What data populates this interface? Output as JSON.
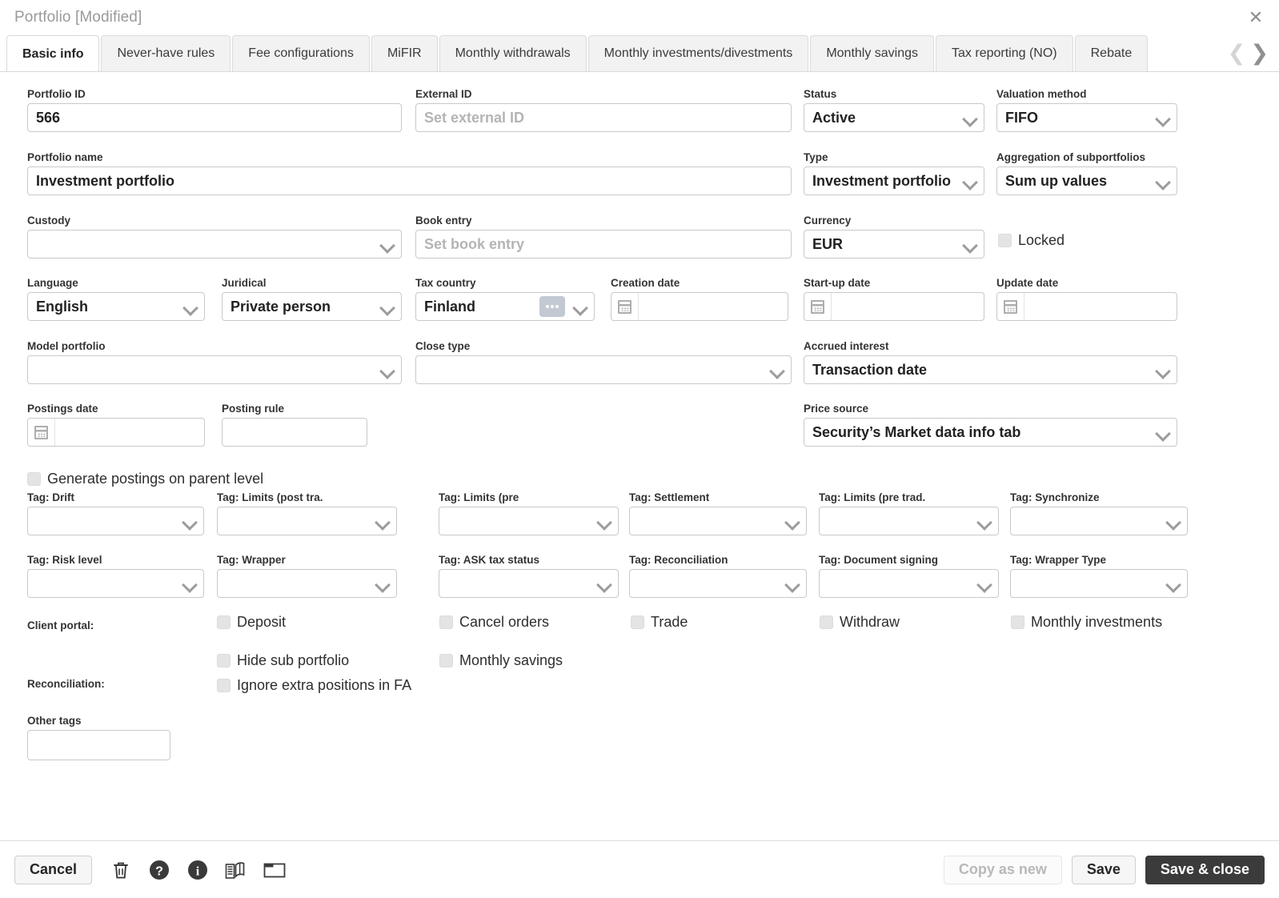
{
  "window": {
    "title": "Portfolio [Modified]",
    "close_icon": "close-icon"
  },
  "tabs": {
    "items": [
      {
        "label": "Basic info",
        "active": true
      },
      {
        "label": "Never-have rules",
        "active": false
      },
      {
        "label": "Fee configurations",
        "active": false
      },
      {
        "label": "MiFIR",
        "active": false
      },
      {
        "label": "Monthly withdrawals",
        "active": false
      },
      {
        "label": "Monthly investments/divestments",
        "active": false
      },
      {
        "label": "Monthly savings",
        "active": false
      },
      {
        "label": "Tax reporting (NO)",
        "active": false
      },
      {
        "label": "Rebate",
        "active": false
      }
    ],
    "prev_arrow": "❮",
    "next_arrow": "❯"
  },
  "form": {
    "portfolio_id": {
      "label": "Portfolio ID",
      "value": "566"
    },
    "external_id": {
      "label": "External ID",
      "value": "",
      "placeholder": "Set external ID"
    },
    "status": {
      "label": "Status",
      "value": "Active"
    },
    "valuation_method": {
      "label": "Valuation method",
      "value": "FIFO"
    },
    "portfolio_name": {
      "label": "Portfolio name",
      "value": "Investment portfolio"
    },
    "type": {
      "label": "Type",
      "value": "Investment portfolio"
    },
    "aggregation": {
      "label": "Aggregation of subportfolios",
      "value": "Sum up values"
    },
    "custody": {
      "label": "Custody",
      "value": ""
    },
    "book_entry": {
      "label": "Book entry",
      "value": "",
      "placeholder": "Set book entry"
    },
    "currency": {
      "label": "Currency",
      "value": "EUR"
    },
    "locked": {
      "label": "Locked",
      "checked": false
    },
    "language": {
      "label": "Language",
      "value": "English"
    },
    "juridical": {
      "label": "Juridical",
      "value": "Private person"
    },
    "tax_country": {
      "label": "Tax country",
      "value": "Finland"
    },
    "creation_date": {
      "label": "Creation date",
      "value": ""
    },
    "startup_date": {
      "label": "Start-up date",
      "value": ""
    },
    "update_date": {
      "label": "Update date",
      "value": ""
    },
    "model_portfolio": {
      "label": "Model portfolio",
      "value": ""
    },
    "close_type": {
      "label": "Close type",
      "value": ""
    },
    "accrued_interest": {
      "label": "Accrued interest",
      "value": "Transaction date"
    },
    "postings_date": {
      "label": "Postings date",
      "value": ""
    },
    "posting_rule": {
      "label": "Posting rule",
      "value": ""
    },
    "price_source": {
      "label": "Price source",
      "value": "Security’s Market data info tab"
    },
    "generate_postings": {
      "label": "Generate postings on parent level",
      "checked": false
    },
    "other_tags": {
      "label": "Other tags",
      "value": ""
    }
  },
  "tags_row1": [
    {
      "label": "Tag: Drift",
      "value": ""
    },
    {
      "label": "Tag: Limits (post tra.",
      "value": ""
    },
    {
      "label": "Tag: Limits (pre",
      "value": ""
    },
    {
      "label": "Tag: Settlement",
      "value": ""
    },
    {
      "label": "Tag: Limits (pre trad.",
      "value": ""
    },
    {
      "label": "Tag: Synchronize",
      "value": ""
    }
  ],
  "tags_row2": [
    {
      "label": "Tag: Risk level",
      "value": ""
    },
    {
      "label": "Tag: Wrapper",
      "value": ""
    },
    {
      "label": "Tag: ASK tax status",
      "value": ""
    },
    {
      "label": "Tag: Reconciliation",
      "value": ""
    },
    {
      "label": "Tag: Document signing",
      "value": ""
    },
    {
      "label": "Tag: Wrapper Type",
      "value": ""
    }
  ],
  "client_portal": {
    "label": "Client portal:",
    "checkboxes": [
      {
        "label": "Deposit",
        "checked": false
      },
      {
        "label": "Cancel orders",
        "checked": false
      },
      {
        "label": "Trade",
        "checked": false
      },
      {
        "label": "Withdraw",
        "checked": false
      },
      {
        "label": "Monthly investments",
        "checked": false
      }
    ],
    "row2": [
      {
        "label": "Hide sub portfolio",
        "checked": false
      },
      {
        "label": "Monthly savings",
        "checked": false
      }
    ]
  },
  "reconciliation": {
    "label": "Reconciliation:",
    "checkboxes": [
      {
        "label": "Ignore extra positions in FA",
        "checked": false
      }
    ]
  },
  "footer": {
    "cancel_label": "Cancel",
    "icons": [
      {
        "name": "trash-icon"
      },
      {
        "name": "help-icon"
      },
      {
        "name": "info-icon"
      },
      {
        "name": "journal-icon"
      },
      {
        "name": "window-icon"
      }
    ],
    "copy_as_new_label": "Copy as new",
    "save_label": "Save",
    "save_close_label": "Save & close"
  },
  "colors": {
    "primary_button": "#3b3b3b",
    "border": "#c9c9c9",
    "tab_inactive_bg": "#f2f2f2",
    "placeholder": "#b4b4b4"
  }
}
